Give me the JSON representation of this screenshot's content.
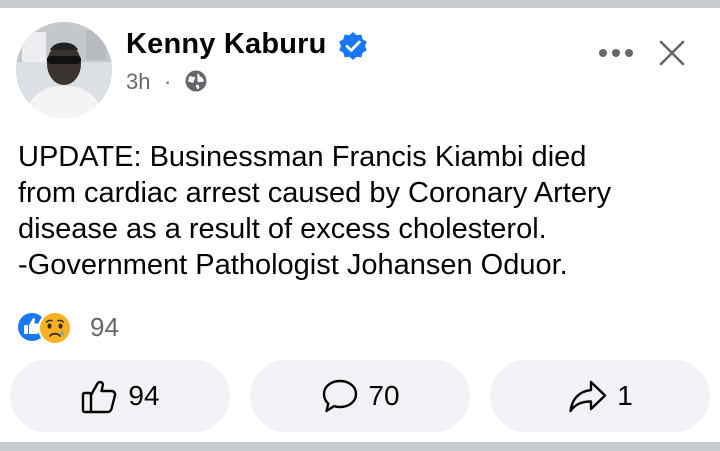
{
  "post": {
    "author": "Kenny Kaburu",
    "time": "3h",
    "separator": "·",
    "audience_icon": "globe-icon",
    "verified_icon": "verified-badge-icon",
    "lines": [
      "UPDATE: Businessman Francis Kiambi died",
      "from cardiac arrest caused by Coronary Artery",
      "disease as a result of excess cholesterol.",
      "-Government Pathologist Johansen Oduor."
    ]
  },
  "reactions": {
    "icons": [
      "like-reaction-icon",
      "sad-reaction-icon"
    ],
    "count": "94"
  },
  "actions": {
    "like_count": "94",
    "comment_count": "70",
    "share_count": "1"
  },
  "colors": {
    "accent": "#1877f2",
    "verified": "#1877f2",
    "muted_text": "#65676b",
    "button_bg": "#f0f2f5",
    "divider": "#c9ccd1"
  }
}
